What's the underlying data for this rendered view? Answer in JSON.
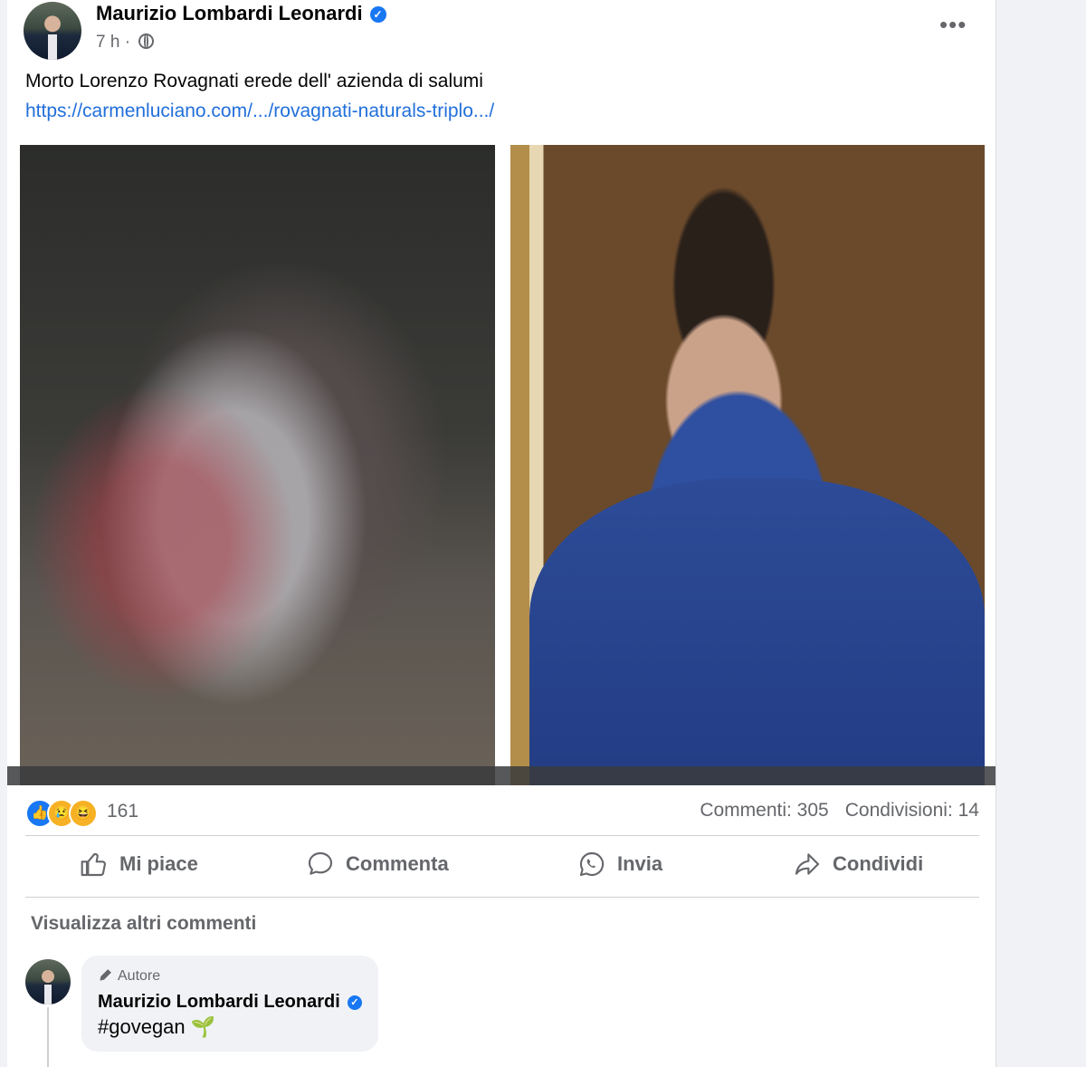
{
  "post": {
    "author": "Maurizio Lombardi Leonardi",
    "time": "7 h",
    "separator": "·",
    "text": "Morto Lorenzo Rovagnati erede dell' azienda di salumi",
    "link": "https://carmenluciano.com/.../rovagnati-naturals-triplo.../",
    "more_label": "•••"
  },
  "reactions": {
    "count": "161",
    "comments": "Commenti: 305",
    "shares": "Condivisioni: 14"
  },
  "actions": {
    "like": "Mi piace",
    "comment": "Commenta",
    "send": "Invia",
    "share": "Condividi"
  },
  "comments": {
    "view_more": "Visualizza altri commenti",
    "author_tag": "Autore",
    "name": "Maurizio Lombardi Leonardi",
    "text": "#govegan 🌱"
  },
  "colors": {
    "accent": "#1877f2",
    "link": "#216fdb",
    "muted": "#65676b"
  }
}
